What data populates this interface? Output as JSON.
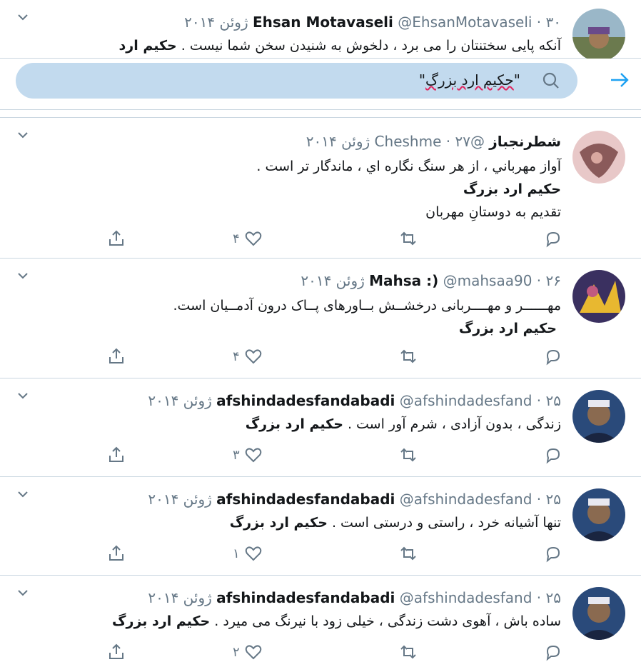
{
  "search": {
    "query_open": "\"",
    "query_word": "حکیم ارد بزرگ",
    "query_close": "\""
  },
  "tweets": [
    {
      "name": "Ehsan Motavaseli",
      "handle": "@EhsanMotavaseli",
      "date": "۳۰ ژوئن ۲۰۱۴",
      "lines": [
        "آنکه پایی سختنتان را می برد ، دلخوش به شنیدن سخن شما نیست . "
      ],
      "bold": "حکیم ارد",
      "likes": ""
    },
    {
      "name": "شطرنجباز",
      "handle": "@Cheshme",
      "date": "۲۷ ژوئن ۲۰۱۴",
      "lines": [
        "آواز مهرباني ، از هر سنگ نگاره اي ، ماندگار تر است ."
      ],
      "bold": "حکیم ارد بزرگ",
      "extra": "تقديم به دوستانِ مهربان",
      "likes": "۴"
    },
    {
      "name": "Mahsa :)",
      "handle": "@mahsaa90",
      "date": "۲۶ ژوئن ۲۰۱۴",
      "lines": [
        "مهــــــر و مهــــربانی درخشــش بــاورهای پــاک درون آدمــیان است."
      ],
      "bold": "حکیم ارد بزرگ",
      "likes": "۴"
    },
    {
      "name": "afshindadesfandabadi",
      "handle": "@afshindadesfand",
      "date": "۲۵ ژوئن ۲۰۱۴",
      "lines": [
        "زندگی ، بدون آزادی ، شرم آور است . "
      ],
      "bold": "حکیم ارد بزرگ",
      "likes": "۳"
    },
    {
      "name": "afshindadesfandabadi",
      "handle": "@afshindadesfand",
      "date": "۲۵ ژوئن ۲۰۱۴",
      "lines": [
        "تنها آشیانه خرد ، راستی و درستی است . "
      ],
      "bold": "حکیم ارد بزرگ",
      "likes": "۱"
    },
    {
      "name": "afshindadesfandabadi",
      "handle": "@afshindadesfand",
      "date": "۲۵ ژوئن ۲۰۱۴",
      "lines": [
        "ساده باش ، آهوی دشت زندگی ، خیلی زود با نیرنگ می میرد . "
      ],
      "bold": "حکیم ارد بزرگ",
      "likes": "۲"
    }
  ],
  "colors": {
    "accent": "#1da1f2",
    "icon": "#657786",
    "search_bg": "#c2daee"
  }
}
